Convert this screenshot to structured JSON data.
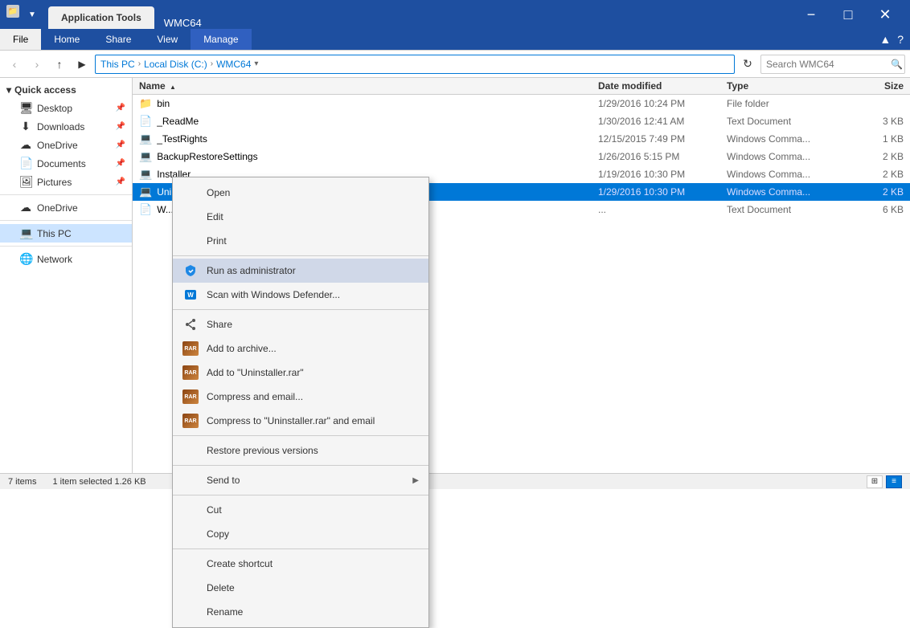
{
  "window": {
    "title": "WMC64",
    "app_tab": "Application Tools",
    "controls": {
      "minimize": "−",
      "maximize": "□",
      "close": "✕"
    }
  },
  "ribbon": {
    "tabs": [
      "File",
      "Home",
      "Share",
      "View",
      "Manage"
    ],
    "active_tab": "Manage"
  },
  "address": {
    "path_parts": [
      "This PC",
      "Local Disk (C:)",
      "WMC64"
    ],
    "search_placeholder": "Search WMC64",
    "search_label": "Search WMC64"
  },
  "sidebar": {
    "quick_access_label": "Quick access",
    "items_quick": [
      {
        "label": "Desktop",
        "icon": "🖥",
        "pinned": true
      },
      {
        "label": "Downloads",
        "icon": "⬇",
        "pinned": true
      },
      {
        "label": "OneDrive",
        "icon": "☁",
        "pinned": true
      },
      {
        "label": "Documents",
        "icon": "📄",
        "pinned": true
      },
      {
        "label": "Pictures",
        "icon": "🖼",
        "pinned": true
      }
    ],
    "onedrive_label": "OneDrive",
    "thispc_label": "This PC",
    "network_label": "Network"
  },
  "files": {
    "columns": [
      "Name",
      "Date modified",
      "Type",
      "Size"
    ],
    "rows": [
      {
        "name": "bin",
        "icon": "📁",
        "date": "1/29/2016 10:24 PM",
        "type": "File folder",
        "size": "",
        "selected": false
      },
      {
        "name": "_ReadMe",
        "icon": "📄",
        "date": "1/30/2016 12:41 AM",
        "type": "Text Document",
        "size": "3 KB",
        "selected": false
      },
      {
        "name": "_TestRights",
        "icon": "💻",
        "date": "12/15/2015 7:49 PM",
        "type": "Windows Comma...",
        "size": "1 KB",
        "selected": false
      },
      {
        "name": "BackupRestoreSettings",
        "icon": "💻",
        "date": "1/26/2016 5:15 PM",
        "type": "Windows Comma...",
        "size": "2 KB",
        "selected": false
      },
      {
        "name": "Installer",
        "icon": "💻",
        "date": "1/19/2016 10:30 PM",
        "type": "Windows Comma...",
        "size": "2 KB",
        "selected": false
      },
      {
        "name": "Uninstaller",
        "icon": "💻",
        "date": "1/29/2016 10:30 PM",
        "type": "Windows Comma...",
        "size": "2 KB",
        "selected": true,
        "highlighted": true
      },
      {
        "name": "W...",
        "icon": "📄",
        "date": "...",
        "type": "Text Document",
        "size": "6 KB",
        "selected": false
      }
    ],
    "status": "7 items",
    "selection_status": "1 item selected  1.26 KB"
  },
  "context_menu": {
    "items": [
      {
        "label": "Open",
        "icon": "open",
        "has_icon": false,
        "separator_after": false
      },
      {
        "label": "Edit",
        "icon": "",
        "has_icon": false,
        "separator_after": false
      },
      {
        "label": "Print",
        "icon": "",
        "has_icon": false,
        "separator_after": true
      },
      {
        "label": "Run as administrator",
        "icon": "shield",
        "has_icon": true,
        "separator_after": false,
        "active": true
      },
      {
        "label": "Scan with Windows Defender...",
        "icon": "defender",
        "has_icon": true,
        "separator_after": true
      },
      {
        "label": "Share",
        "icon": "share",
        "has_icon": true,
        "separator_after": false
      },
      {
        "label": "Add to archive...",
        "icon": "rar",
        "has_icon": true,
        "separator_after": false
      },
      {
        "label": "Add to \"Uninstaller.rar\"",
        "icon": "rar",
        "has_icon": true,
        "separator_after": false
      },
      {
        "label": "Compress and email...",
        "icon": "rar",
        "has_icon": true,
        "separator_after": false
      },
      {
        "label": "Compress to \"Uninstaller.rar\" and email",
        "icon": "rar",
        "has_icon": true,
        "separator_after": true
      },
      {
        "label": "Restore previous versions",
        "icon": "",
        "has_icon": false,
        "separator_after": true
      },
      {
        "label": "Send to",
        "icon": "",
        "has_icon": false,
        "has_arrow": true,
        "separator_after": true
      },
      {
        "label": "Cut",
        "icon": "",
        "has_icon": false,
        "separator_after": false
      },
      {
        "label": "Copy",
        "icon": "",
        "has_icon": false,
        "separator_after": true
      },
      {
        "label": "Create shortcut",
        "icon": "",
        "has_icon": false,
        "separator_after": false
      },
      {
        "label": "Delete",
        "icon": "",
        "has_icon": false,
        "separator_after": false
      },
      {
        "label": "Rename",
        "icon": "",
        "has_icon": false,
        "separator_after": false
      }
    ]
  }
}
